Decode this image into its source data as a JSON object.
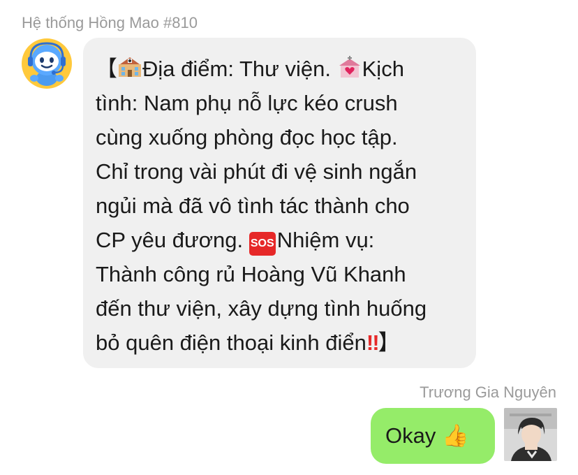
{
  "incoming": {
    "sender_name": "Hệ thống Hồng Mao #810",
    "avatar_icon": "robot-headset-icon",
    "message": {
      "line1_open": "【",
      "line1_text_a": "Địa điểm: Thư viện. ",
      "line1_text_b": "Kịch",
      "line2": "tình: Nam phụ nỗ lực kéo crush",
      "line3": "cùng xuống phòng đọc học tập.",
      "line4": "Chỉ trong vài phút đi vệ sinh ngắn",
      "line5": "ngủi mà đã vô tình tác thành cho",
      "line6_a": "CP yêu đương. ",
      "sos_label": "SOS",
      "line6_b": "Nhiệm vụ:",
      "line7": "Thành công rủ Hoàng Vũ Khanh",
      "line8": "đến thư viện, xây dựng tình huống",
      "line9": "bỏ quên điện thoại kinh điển",
      "line9_bang": "‼",
      "line9_close": "】"
    }
  },
  "outgoing": {
    "sender_name": "Trương Gia Nguyên",
    "message_text": "Okay ",
    "message_emoji": "👍",
    "avatar_icon": "user-photo-avatar"
  },
  "colors": {
    "incoming_bubble": "#f0f0f0",
    "outgoing_bubble": "#95ec69",
    "name_gray": "#9a9a9a"
  }
}
